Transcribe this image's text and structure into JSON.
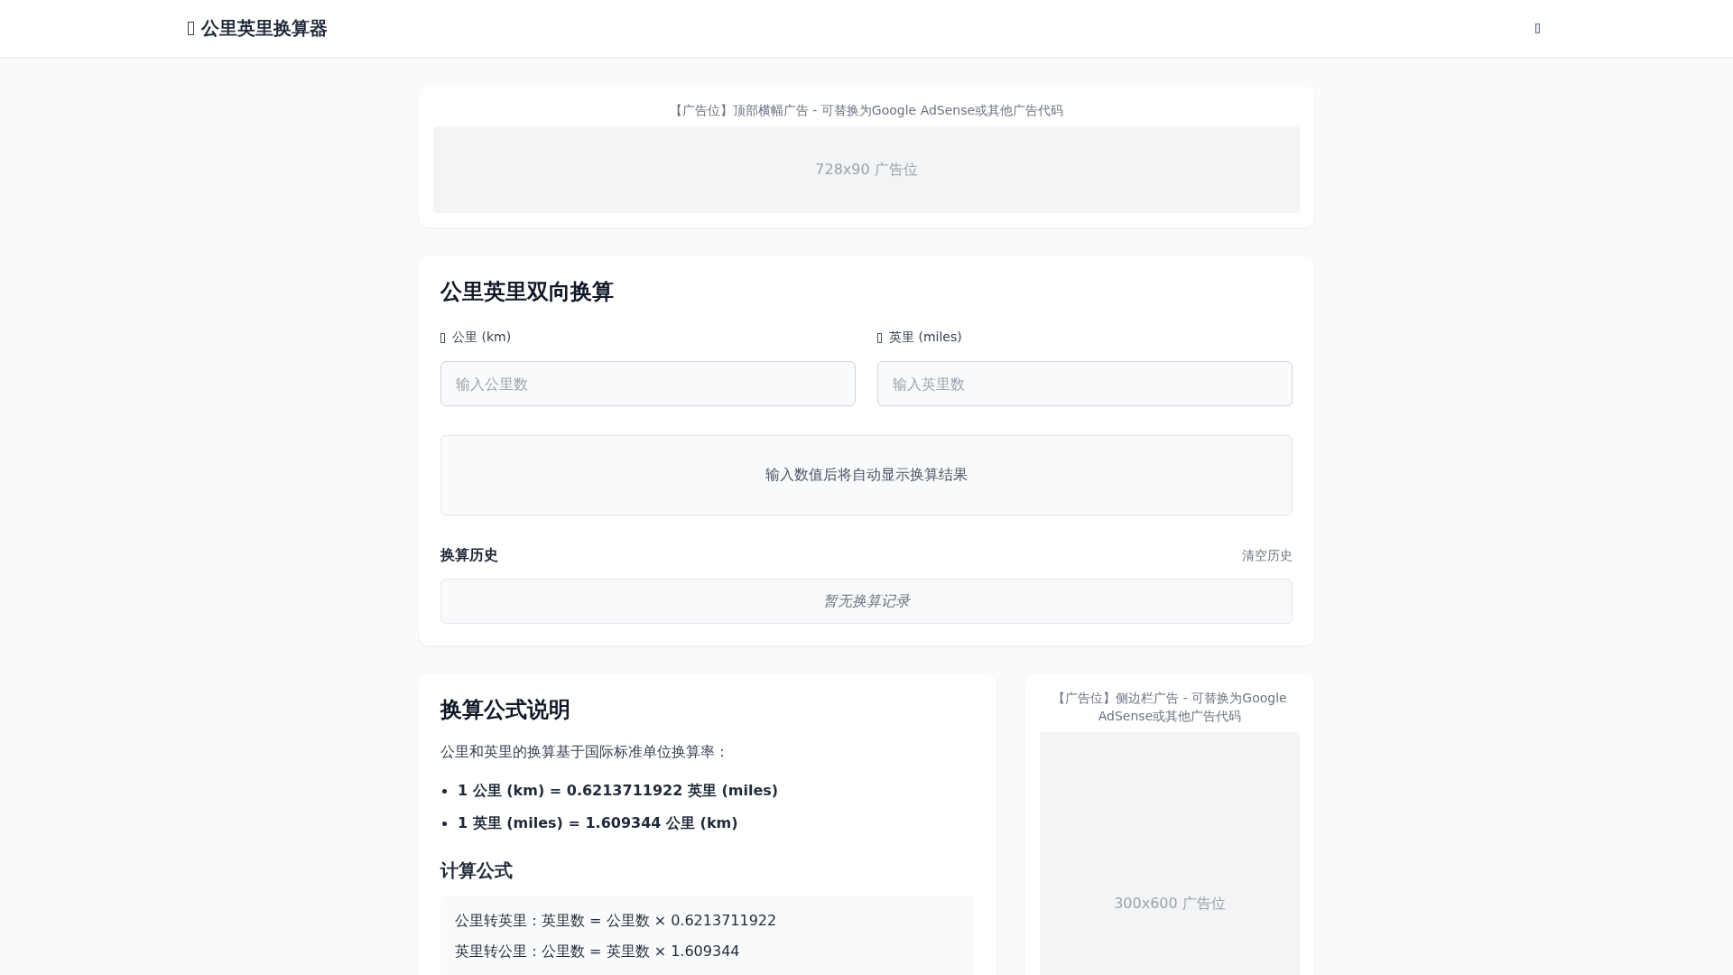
{
  "header": {
    "title": "公里英里换算器"
  },
  "top_ad": {
    "caption": "【广告位】顶部横幅广告 - 可替换为Google AdSense或其他广告代码",
    "placeholder": "728x90 广告位"
  },
  "converter": {
    "title": "公里英里双向换算",
    "fields": [
      {
        "label": "公里 (km)",
        "placeholder": "输入公里数"
      },
      {
        "label": "英里 (miles)",
        "placeholder": "输入英里数"
      }
    ],
    "result": "输入数值后将自动显示换算结果",
    "history": {
      "title": "换算历史",
      "clear": "清空历史",
      "empty": "暂无换算记录"
    }
  },
  "formula": {
    "title": "换算公式说明",
    "intro": "公里和英里的换算基于国际标准单位换算率：",
    "rates": [
      "1 公里 (km) = 0.6213711922 英里 (miles)",
      "1 英里 (miles) = 1.609344 公里 (km)"
    ],
    "subtitle": "计算公式",
    "lines": [
      "公里转英里：英里数 = 公里数 × 0.6213711922",
      "英里转公里：公里数 = 英里数 × 1.609344"
    ]
  },
  "side_ad": {
    "caption": "【广告位】侧边栏广告 - 可替换为Google AdSense或其他广告代码",
    "placeholder": "300x600 广告位"
  }
}
